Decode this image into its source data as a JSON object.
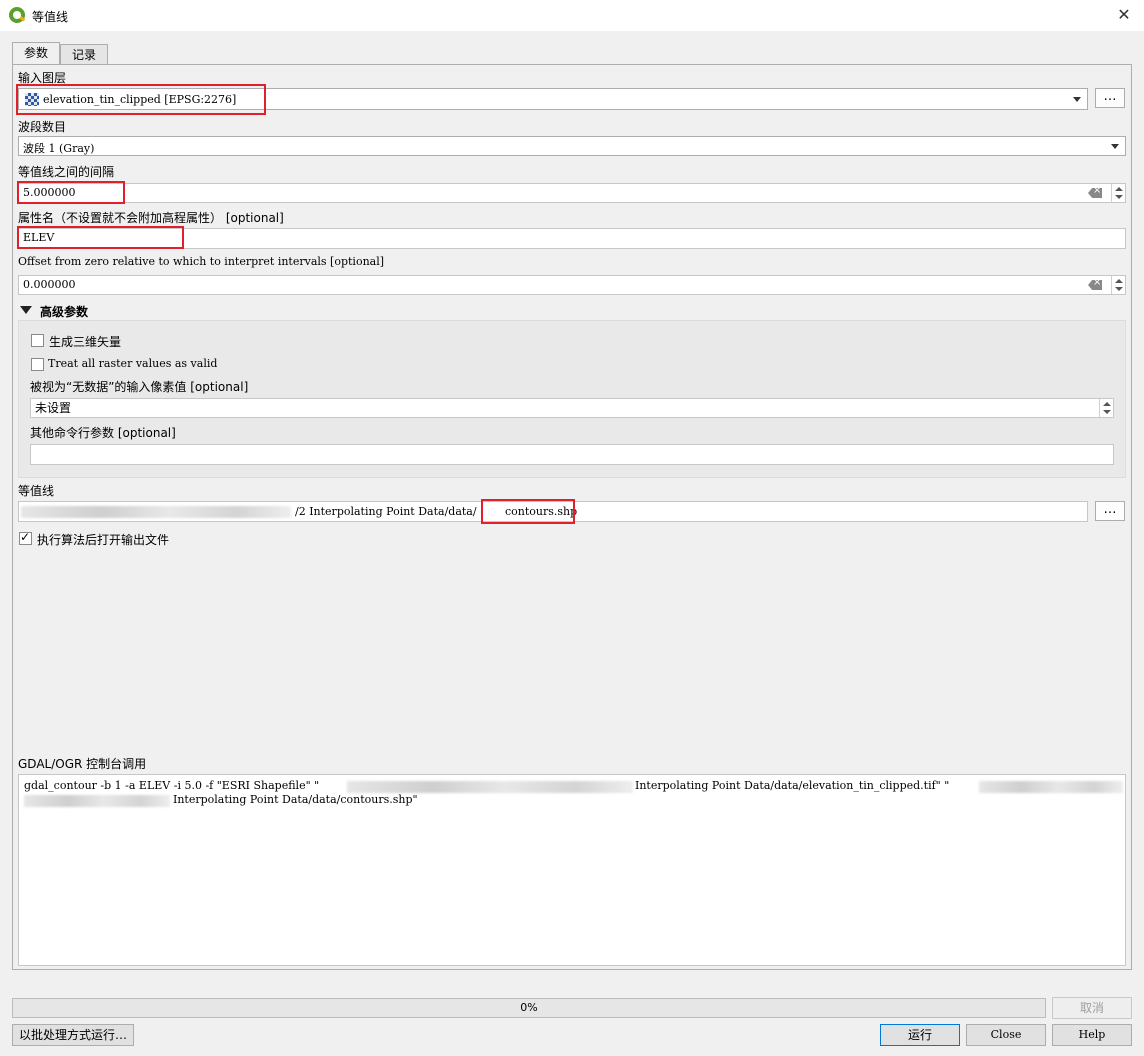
{
  "window": {
    "title": "等值线",
    "close_glyph": "✕"
  },
  "tabs": [
    {
      "label": "参数"
    },
    {
      "label": "记录"
    }
  ],
  "params": {
    "input_layer": {
      "label": "输入图层",
      "value": "elevation_tin_clipped [EPSG:2276]",
      "browse_label": "…"
    },
    "band": {
      "label": "波段数目",
      "value": "波段 1 (Gray)"
    },
    "interval": {
      "label": "等值线之间的间隔",
      "value": "5.000000"
    },
    "attribute_name": {
      "label": "属性名（不设置就不会附加高程属性） [optional]",
      "value": "ELEV"
    },
    "offset": {
      "label": "Offset from zero relative to which to interpret intervals [optional]",
      "value": "0.000000"
    },
    "advanced": {
      "title": "高级参数",
      "create_3d": {
        "label": "生成三维矢量",
        "checked": false
      },
      "all_valid": {
        "label": "Treat all raster values as valid",
        "checked": false
      },
      "nodata": {
        "label": "被视为“无数据”的输入像素值 [optional]",
        "value": "未设置"
      },
      "extra": {
        "label": "其他命令行参数 [optional]",
        "value": ""
      }
    },
    "output": {
      "label": "等值线",
      "value_visible": "/2  Interpolating Point Data/data/",
      "value_highlight": "contours.shp",
      "browse_label": "…"
    },
    "open_after": {
      "label": "执行算法后打开输出文件",
      "checked": true
    }
  },
  "console": {
    "label": "GDAL/OGR 控制台调用",
    "line1_a": "gdal_contour -b 1 -a ELEV -i 5.0 -f \"ESRI Shapefile\" \"",
    "line1_b": "Interpolating Point Data/data/elevation_tin_clipped.tif\" \"",
    "line2_b": "Interpolating Point Data/data/contours.shp\""
  },
  "footer": {
    "progress_value": 0,
    "progress_text": "0%",
    "cancel_label": "取消",
    "batch_label": "以批处理方式运行…",
    "run_label": "运行",
    "close_label": "Close",
    "help_label": "Help"
  }
}
